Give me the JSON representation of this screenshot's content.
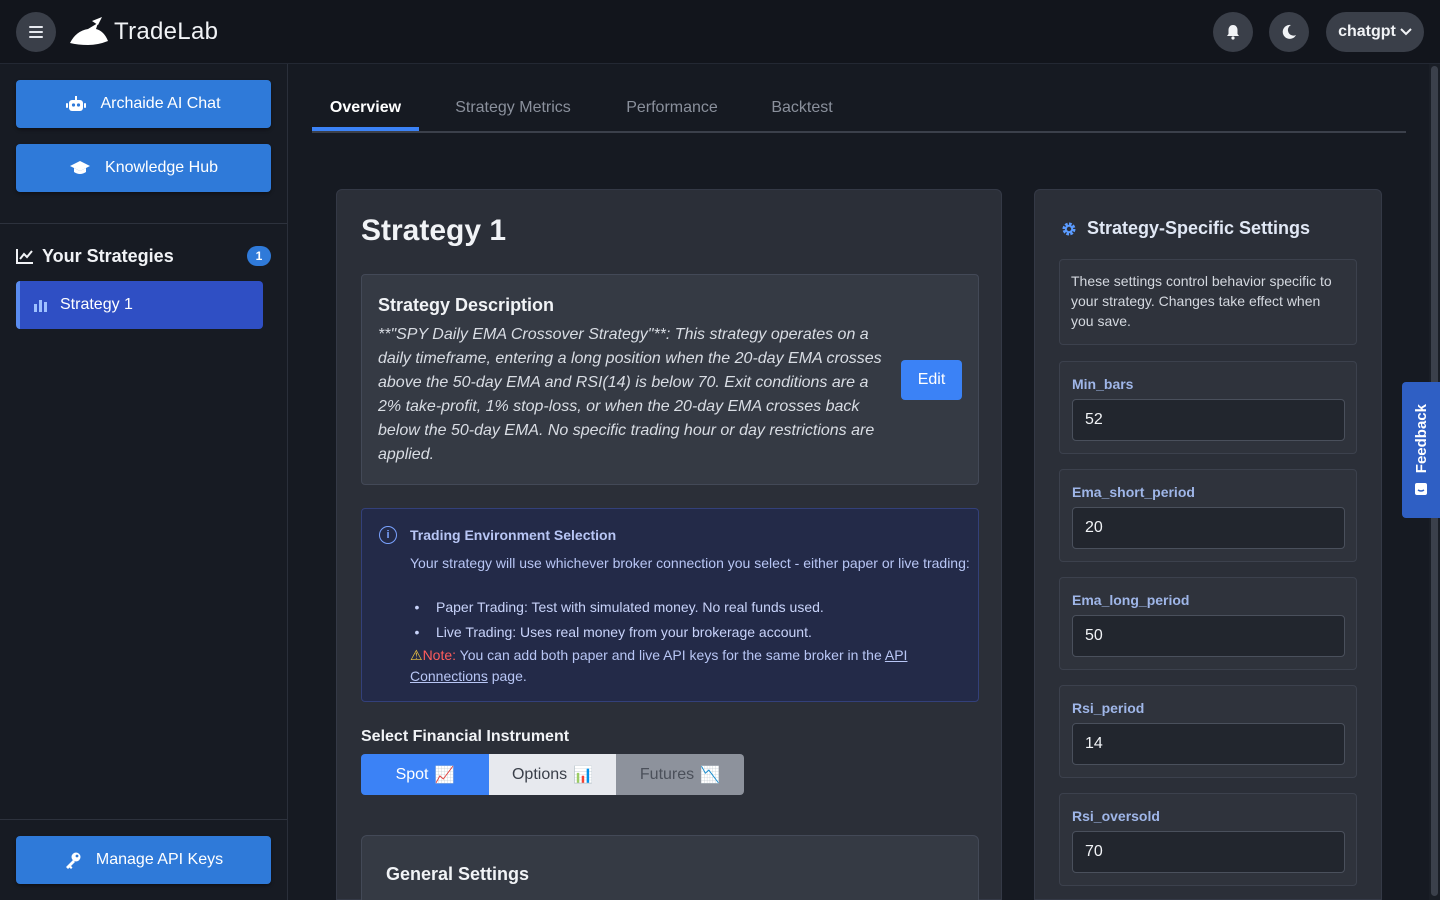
{
  "header": {
    "brand": "TradeLab",
    "user_label": "chatgpt",
    "icons": {
      "menu": "hamburger-icon",
      "bell": "bell-icon",
      "theme": "moon-icon",
      "chevron": "chevron-down-icon"
    }
  },
  "sidebar": {
    "primary_buttons": [
      {
        "label": "Archaide AI Chat",
        "icon": "robot-icon"
      },
      {
        "label": "Knowledge Hub",
        "icon": "graduation-cap-icon"
      }
    ],
    "strategies_heading": "Your Strategies",
    "strategies_count": "1",
    "strategies": [
      {
        "label": "Strategy 1",
        "icon": "bar-chart-icon"
      }
    ],
    "manage_keys_label": "Manage API Keys"
  },
  "tabs": [
    {
      "label": "Overview",
      "active": true
    },
    {
      "label": "Strategy Metrics",
      "active": false
    },
    {
      "label": "Performance",
      "active": false
    },
    {
      "label": "Backtest",
      "active": false
    }
  ],
  "strategy": {
    "title": "Strategy 1",
    "description_heading": "Strategy Description",
    "description": "**\"SPY Daily EMA Crossover Strategy\"**: This strategy operates on a daily timeframe, entering a long position when the 20-day EMA crosses above the 50-day EMA and RSI(14) is below 70. Exit conditions are a 2% take-profit, 1% stop-loss, or when the 20-day EMA crosses back below the 50-day EMA. No specific trading hour or day restrictions are applied.",
    "edit_label": "Edit"
  },
  "environment": {
    "title": "Trading Environment Selection",
    "intro": "Your strategy will use whichever broker connection you select - either paper or live trading:",
    "bullets": [
      "Paper Trading: Test with simulated money. No real funds used.",
      "Live Trading: Uses real money from your brokerage account."
    ],
    "note_label": "Note:",
    "note_text": " You can add both paper and live API keys for the same broker in the ",
    "note_link": "API Connections",
    "note_tail": " page."
  },
  "instrument": {
    "label": "Select Financial Instrument",
    "options": [
      {
        "label": "Spot",
        "emoji": "📈",
        "selected": true
      },
      {
        "label": "Options",
        "emoji": "📊",
        "selected": false
      },
      {
        "label": "Futures",
        "emoji": "📉",
        "selected": false
      }
    ]
  },
  "general_settings_title": "General Settings",
  "settings_panel": {
    "title": "Strategy-Specific Settings",
    "info": "These settings control behavior specific to your strategy. Changes take effect when you save.",
    "fields": [
      {
        "label": "Min_bars",
        "value": "52"
      },
      {
        "label": "Ema_short_period",
        "value": "20"
      },
      {
        "label": "Ema_long_period",
        "value": "50"
      },
      {
        "label": "Rsi_period",
        "value": "14"
      },
      {
        "label": "Rsi_oversold",
        "value": "70"
      }
    ]
  },
  "feedback_label": "Feedback",
  "colors": {
    "accent": "#3b82f6",
    "panel": "#2b2f38",
    "background": "#161a22"
  }
}
